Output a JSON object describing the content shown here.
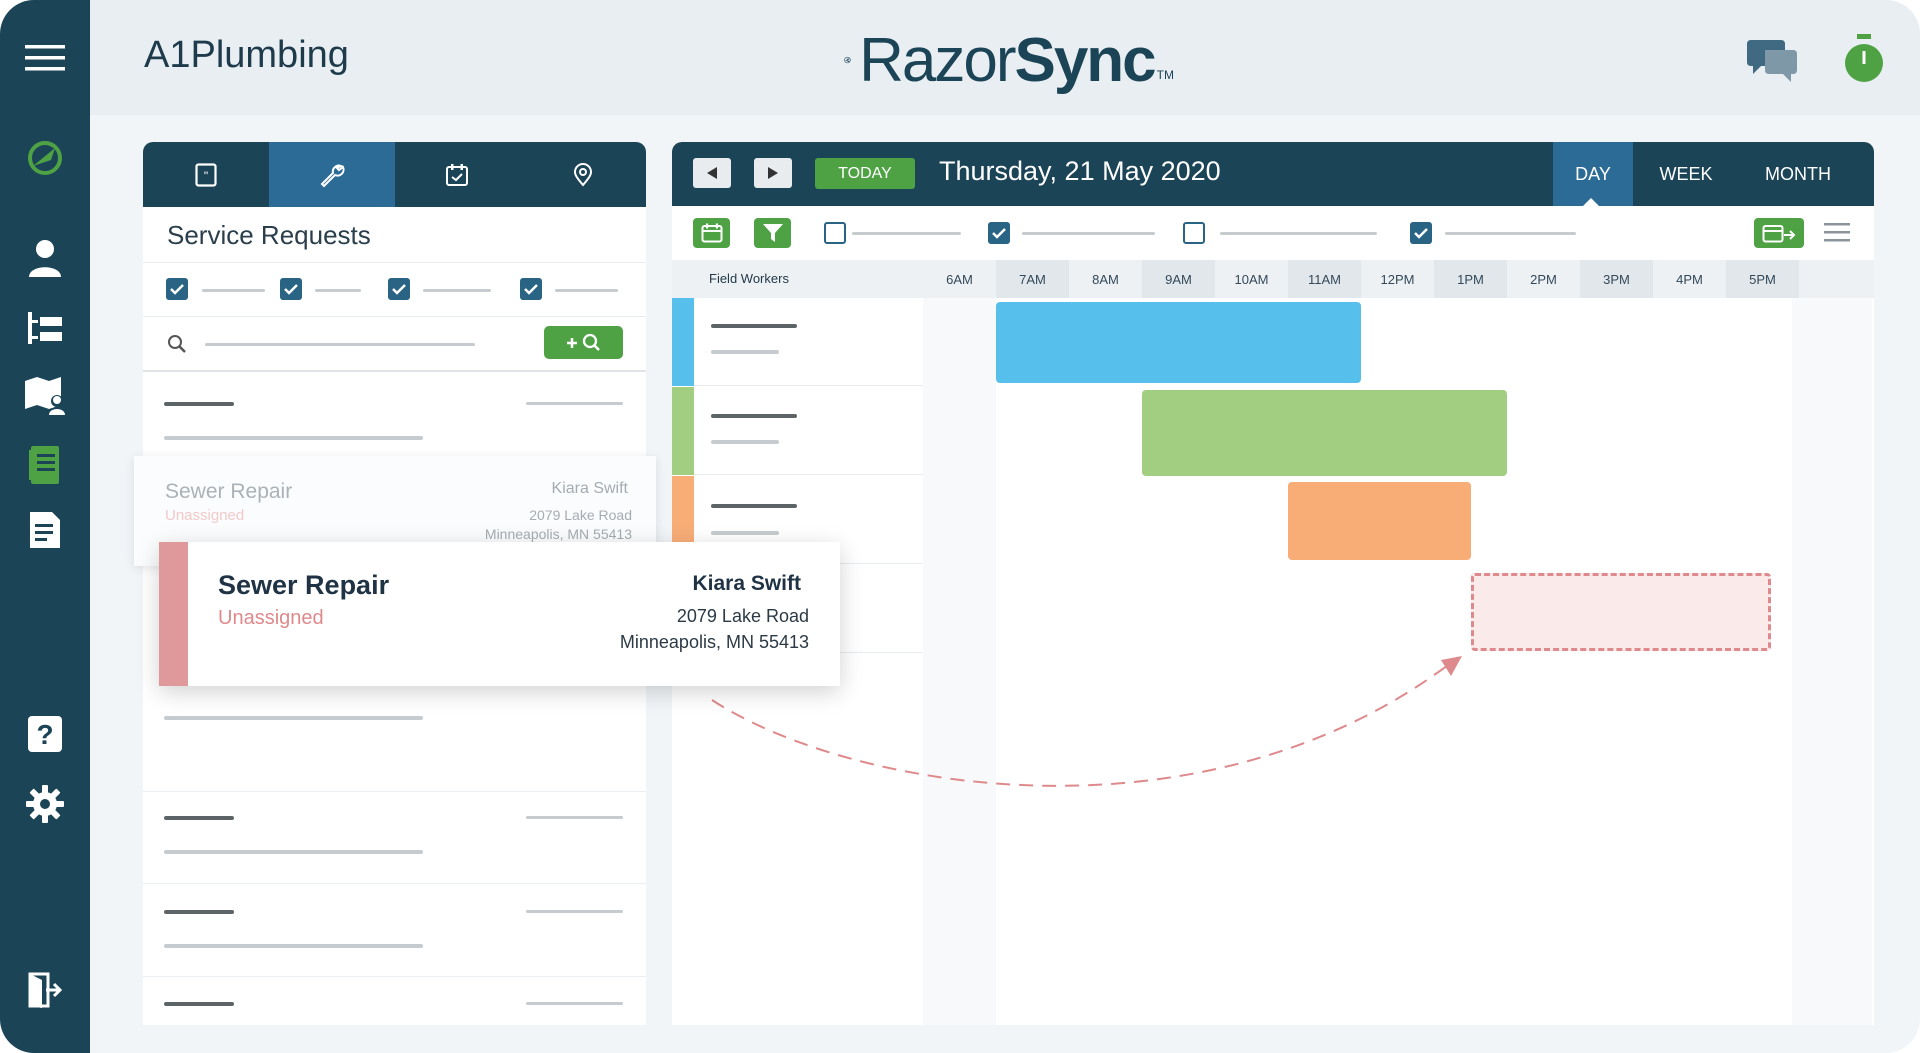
{
  "app": {
    "company_name": "A1Plumbing",
    "brand": {
      "name_light": "Razor",
      "name_bold": "Sync",
      "trademark": "TM"
    }
  },
  "colors": {
    "primary": "#1b4457",
    "accent_blue": "#2c6b96",
    "green": "#4ea244",
    "worker_blue": "#57bfec",
    "worker_green": "#a2ce82",
    "worker_orange": "#f8ad77",
    "worker_pink": "#de8a8c"
  },
  "nav": {
    "items": [
      {
        "name": "menu",
        "icon": "hamburger-icon"
      },
      {
        "name": "dashboard",
        "icon": "logo-icon"
      },
      {
        "name": "customers",
        "icon": "user-icon"
      },
      {
        "name": "hierarchy",
        "icon": "hierarchy-icon"
      },
      {
        "name": "map",
        "icon": "map-user-icon"
      },
      {
        "name": "work-orders",
        "icon": "notebook-icon"
      },
      {
        "name": "invoices",
        "icon": "document-icon"
      },
      {
        "name": "help",
        "icon": "help-icon"
      },
      {
        "name": "settings",
        "icon": "gear-icon"
      },
      {
        "name": "logout",
        "icon": "logout-icon"
      }
    ]
  },
  "header": {
    "icons": [
      "chat-icon",
      "stopwatch-icon"
    ]
  },
  "service_requests": {
    "tabs": [
      {
        "name": "quotes",
        "icon": "quote-icon"
      },
      {
        "name": "service",
        "icon": "wrench-icon",
        "active": true
      },
      {
        "name": "schedule",
        "icon": "calendar-check-icon"
      },
      {
        "name": "locations",
        "icon": "location-pin-icon"
      }
    ],
    "title": "Service Requests",
    "search_button": "+ ⌕"
  },
  "ghost_card": {
    "title": "Sewer Repair",
    "status": "Unassigned",
    "worker": "Kiara Swift",
    "address_line1": "2079 Lake Road",
    "address_line2": "Minneapolis, MN 55413"
  },
  "drag_card": {
    "title": "Sewer Repair",
    "status": "Unassigned",
    "worker": "Kiara Swift",
    "address_line1": "2079 Lake Road",
    "address_line2": "Minneapolis, MN 55413"
  },
  "scheduler": {
    "today_label": "TODAY",
    "date": "Thursday, 21 May 2020",
    "views": [
      "DAY",
      "WEEK",
      "MONTH"
    ],
    "active_view": "DAY",
    "field_workers_label": "Field Workers",
    "hours": [
      "6AM",
      "7AM",
      "8AM",
      "9AM",
      "10AM",
      "11AM",
      "12PM",
      "1PM",
      "2PM",
      "3PM",
      "4PM",
      "5PM"
    ],
    "workers": [
      {
        "color": "#57bfec",
        "job_start_hour": 7,
        "job_end_hour": 12
      },
      {
        "color": "#a2ce82",
        "job_start_hour": 9,
        "job_end_hour": 14
      },
      {
        "color": "#f8ad77",
        "job_start_hour": 11,
        "job_end_hour": 13.5
      },
      {
        "color": "#de8a8c",
        "drop_start_hour": 13.5,
        "drop_end_hour": 18
      }
    ]
  }
}
